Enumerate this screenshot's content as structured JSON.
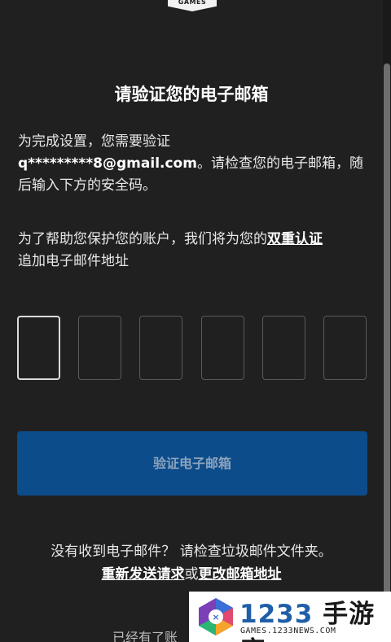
{
  "brand_badge": "GAMES",
  "title": "请验证您的电子邮箱",
  "intro": {
    "before": "为完成设置，您需要验证",
    "email": "q*********8@gmail.com",
    "after": "。请检查您的电子邮箱，随后输入下方的安全码。"
  },
  "mfa_note": {
    "before": "为了帮助您保护您的账户，我们将为您的",
    "link": "双重认证",
    "after": "追加电子邮件地址"
  },
  "code_inputs": [
    "",
    "",
    "",
    "",
    "",
    ""
  ],
  "verify_button": "验证电子邮箱",
  "no_email": {
    "text": "没有收到电子邮件？ 请检查垃圾邮件文件夹。",
    "resend_link": "重新发送请求",
    "or": "或",
    "change_link": "更改邮箱地址"
  },
  "already_text": "已经有了账",
  "ad": {
    "title_num": "1233",
    "title_text": "手游库",
    "subtitle": "GAMES.1233NEWS.COM"
  }
}
